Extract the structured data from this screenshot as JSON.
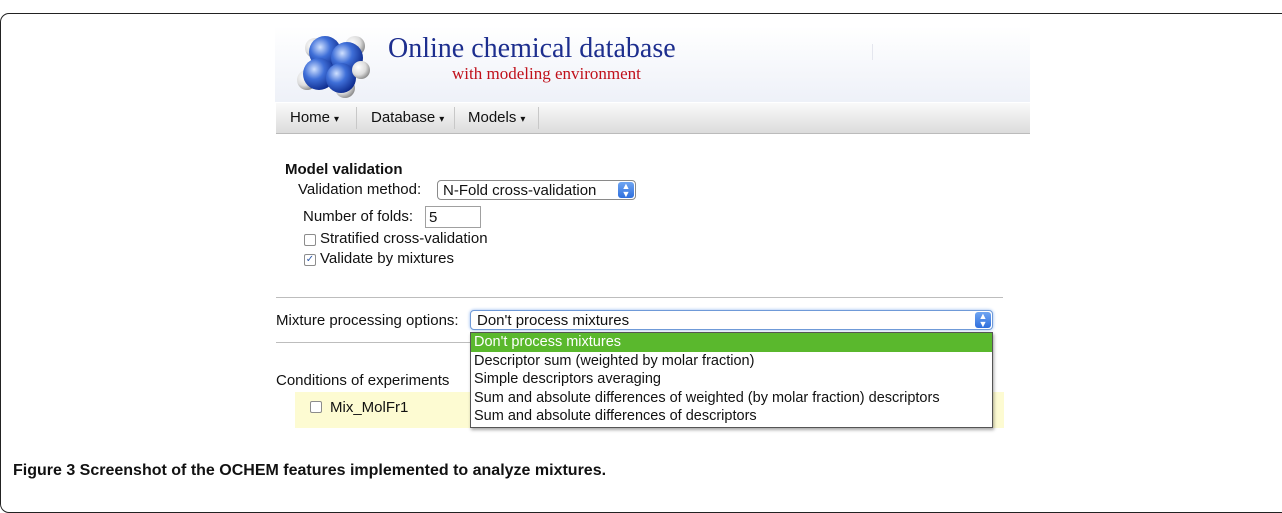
{
  "header": {
    "title": "Online chemical database",
    "subtitle": "with modeling environment",
    "logo_icon": "molecule-logo-icon"
  },
  "nav": {
    "items": [
      {
        "label": "Home"
      },
      {
        "label": "Database"
      },
      {
        "label": "Models"
      }
    ],
    "caret": "▾"
  },
  "validation": {
    "title": "Model validation",
    "method_label": "Validation method:",
    "method_value": "N-Fold cross-validation",
    "folds_label": "Number of folds:",
    "folds_value": "5",
    "stratified_label": "Stratified cross-validation",
    "stratified_checked": false,
    "mixtures_label": "Validate by mixtures",
    "mixtures_checked": true
  },
  "mixture": {
    "label": "Mixture processing options:",
    "value": "Don't process mixtures",
    "options": [
      "Don't process mixtures",
      "Descriptor sum (weighted by molar fraction)",
      "Simple descriptors averaging",
      "Sum and absolute differences of weighted (by molar fraction) descriptors",
      "Sum and absolute differences of descriptors"
    ],
    "selected_index": 0
  },
  "conditions": {
    "label": "Conditions of experiments",
    "item_label": "Mix_MolFr1"
  },
  "caption": {
    "figure": "Figure 3",
    "text": " Screenshot of the OCHEM features implemented to analyze mixtures."
  },
  "colors": {
    "title_blue": "#1d2e8e",
    "subtitle_red": "#c0101a",
    "selected_green": "#5ab82d",
    "conditions_yellow": "#fdfbd2"
  }
}
